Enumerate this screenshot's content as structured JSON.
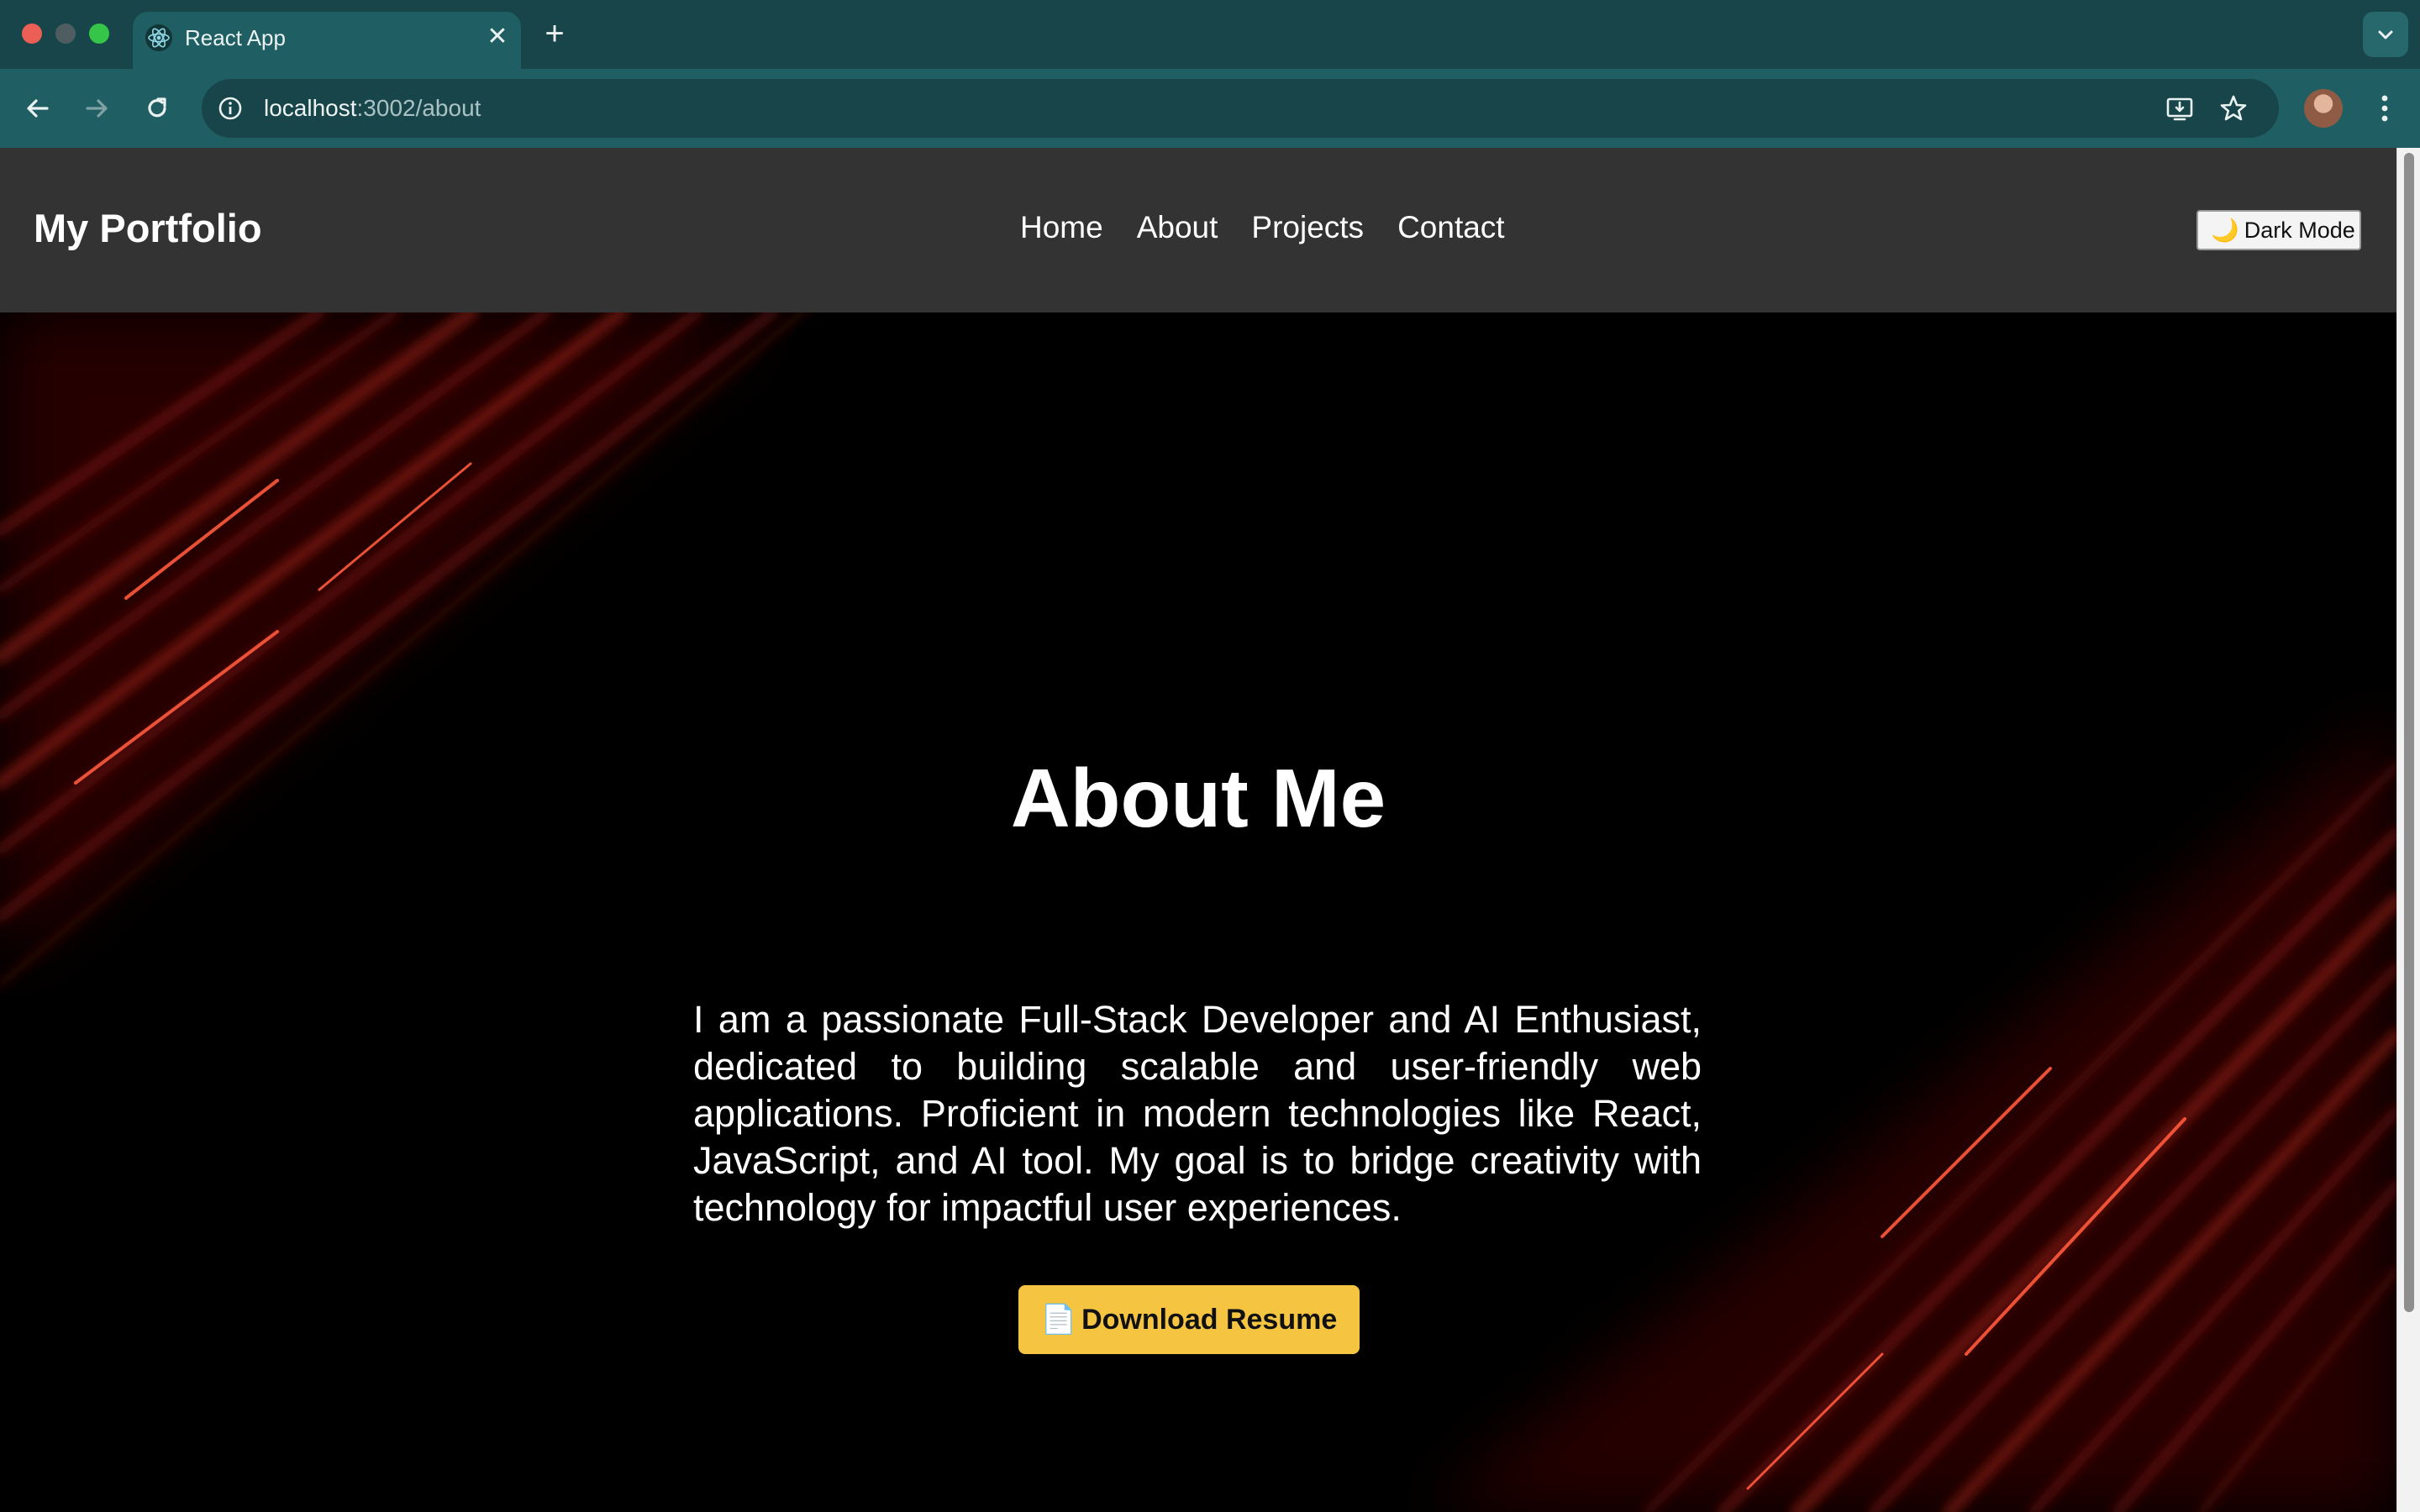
{
  "browser": {
    "tab_title": "React App",
    "url_host": "localhost",
    "url_path": ":3002/about",
    "icons": [
      "react-favicon",
      "close-icon",
      "plus-icon",
      "chevron-down-icon",
      "back-icon",
      "forward-icon",
      "reload-icon",
      "info-icon",
      "install-icon",
      "star-icon",
      "profile-avatar",
      "kebab-menu-icon"
    ]
  },
  "site": {
    "logo": "My Portfolio",
    "nav": [
      "Home",
      "About",
      "Projects",
      "Contact"
    ],
    "mode_toggle_label": "Dark Mode",
    "mode_toggle_icon": "🌙"
  },
  "about": {
    "heading": "About Me",
    "bio": "I am a passionate Full-Stack Developer and AI Enthusiast, dedicated to building scalable and user-friendly web applications. Proficient in modern technologies like React, JavaScript, and AI tool. My goal is to bridge creativity with technology for impactful user experiences.",
    "resume_button_label": "Download Resume",
    "resume_button_icon": "📄"
  },
  "colors": {
    "browser_frame": "#184549",
    "browser_toolbar": "#1f5e62",
    "site_header": "#333333",
    "page_bg": "#000000",
    "accent_button": "#f5c542",
    "streak_red": "#e0231c"
  }
}
